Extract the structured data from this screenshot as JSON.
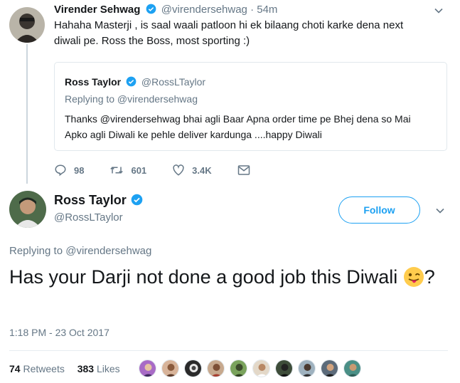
{
  "parent_tweet": {
    "name": "Virender Sehwag",
    "handle": "@virendersehwag",
    "separator": "·",
    "time": "54m",
    "text": "Hahaha Masterji , is saal waali patloon hi ek bilaang choti karke dena next diwali pe. Ross the Boss, most sporting :)",
    "quoted": {
      "name": "Ross Taylor",
      "handle": "@RossLTaylor",
      "replying_to": "Replying to @virendersehwag",
      "text": "Thanks @virendersehwag bhai agli Baar Apna order time pe Bhej dena so Mai Apko agli Diwali ke pehle deliver  kardunga ....happy Diwali"
    },
    "actions": {
      "replies": "98",
      "retweets": "601",
      "likes": "3.4K"
    }
  },
  "main_tweet": {
    "name": "Ross Taylor",
    "handle": "@RossLTaylor",
    "follow_label": "Follow",
    "replying_to": "Replying to @virendersehwag",
    "text_before_emoji": "Has your Darji not done a good job this Diwali ",
    "text_after_emoji": "?",
    "emoji": "winking-face-with-tongue",
    "timestamp": "1:18 PM - 23 Oct 2017",
    "retweets_count": "74",
    "retweets_label": "Retweets",
    "likes_count": "383",
    "likes_label": "Likes"
  },
  "colors": {
    "brand": "#1da1f2",
    "muted": "#657786",
    "text": "#14171a",
    "border": "#e1e8ed"
  }
}
